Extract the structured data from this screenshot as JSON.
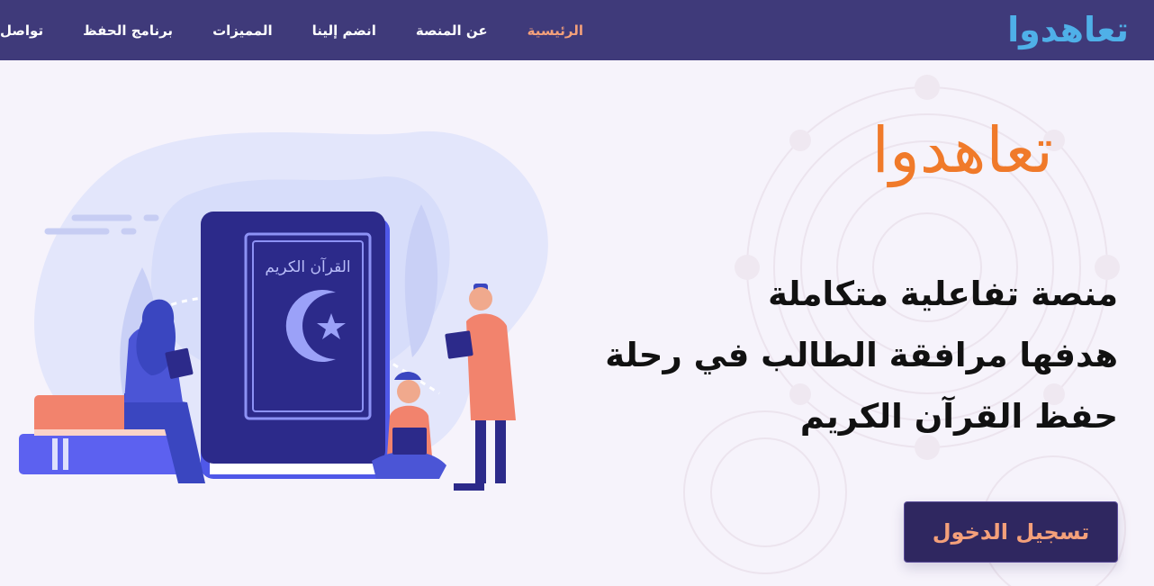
{
  "navbar": {
    "logo": "تعاهدوا",
    "items": [
      {
        "label": "الرئيسية",
        "active": true
      },
      {
        "label": "عن المنصة",
        "active": false
      },
      {
        "label": "انضم إلينا",
        "active": false
      },
      {
        "label": "المميزات",
        "active": false
      },
      {
        "label": "برنامج الحفظ",
        "active": false
      },
      {
        "label": "تواصل معنا",
        "active": false
      }
    ]
  },
  "hero": {
    "brand": "تعاهدوا",
    "headline_lines": [
      "منصة تفاعلية متكاملة",
      "هدفها مرافقة الطالب في رحلة",
      "حفظ القرآن الكريم"
    ],
    "login_label": "تسجيل الدخول",
    "book_title": "القرآن الكريم"
  },
  "colors": {
    "navbar_bg": "#3f3a7a",
    "nav_active": "#f4a07a",
    "logo_blue": "#4fb0e8",
    "brand_orange": "#f07a2a",
    "button_bg": "#2f2760",
    "button_text": "#f4a07a",
    "book_blue": "#2c2a8a"
  },
  "icons": {
    "illustration": "quran-readers-illustration",
    "book": "quran-book-icon",
    "crescent": "crescent-star-icon"
  }
}
